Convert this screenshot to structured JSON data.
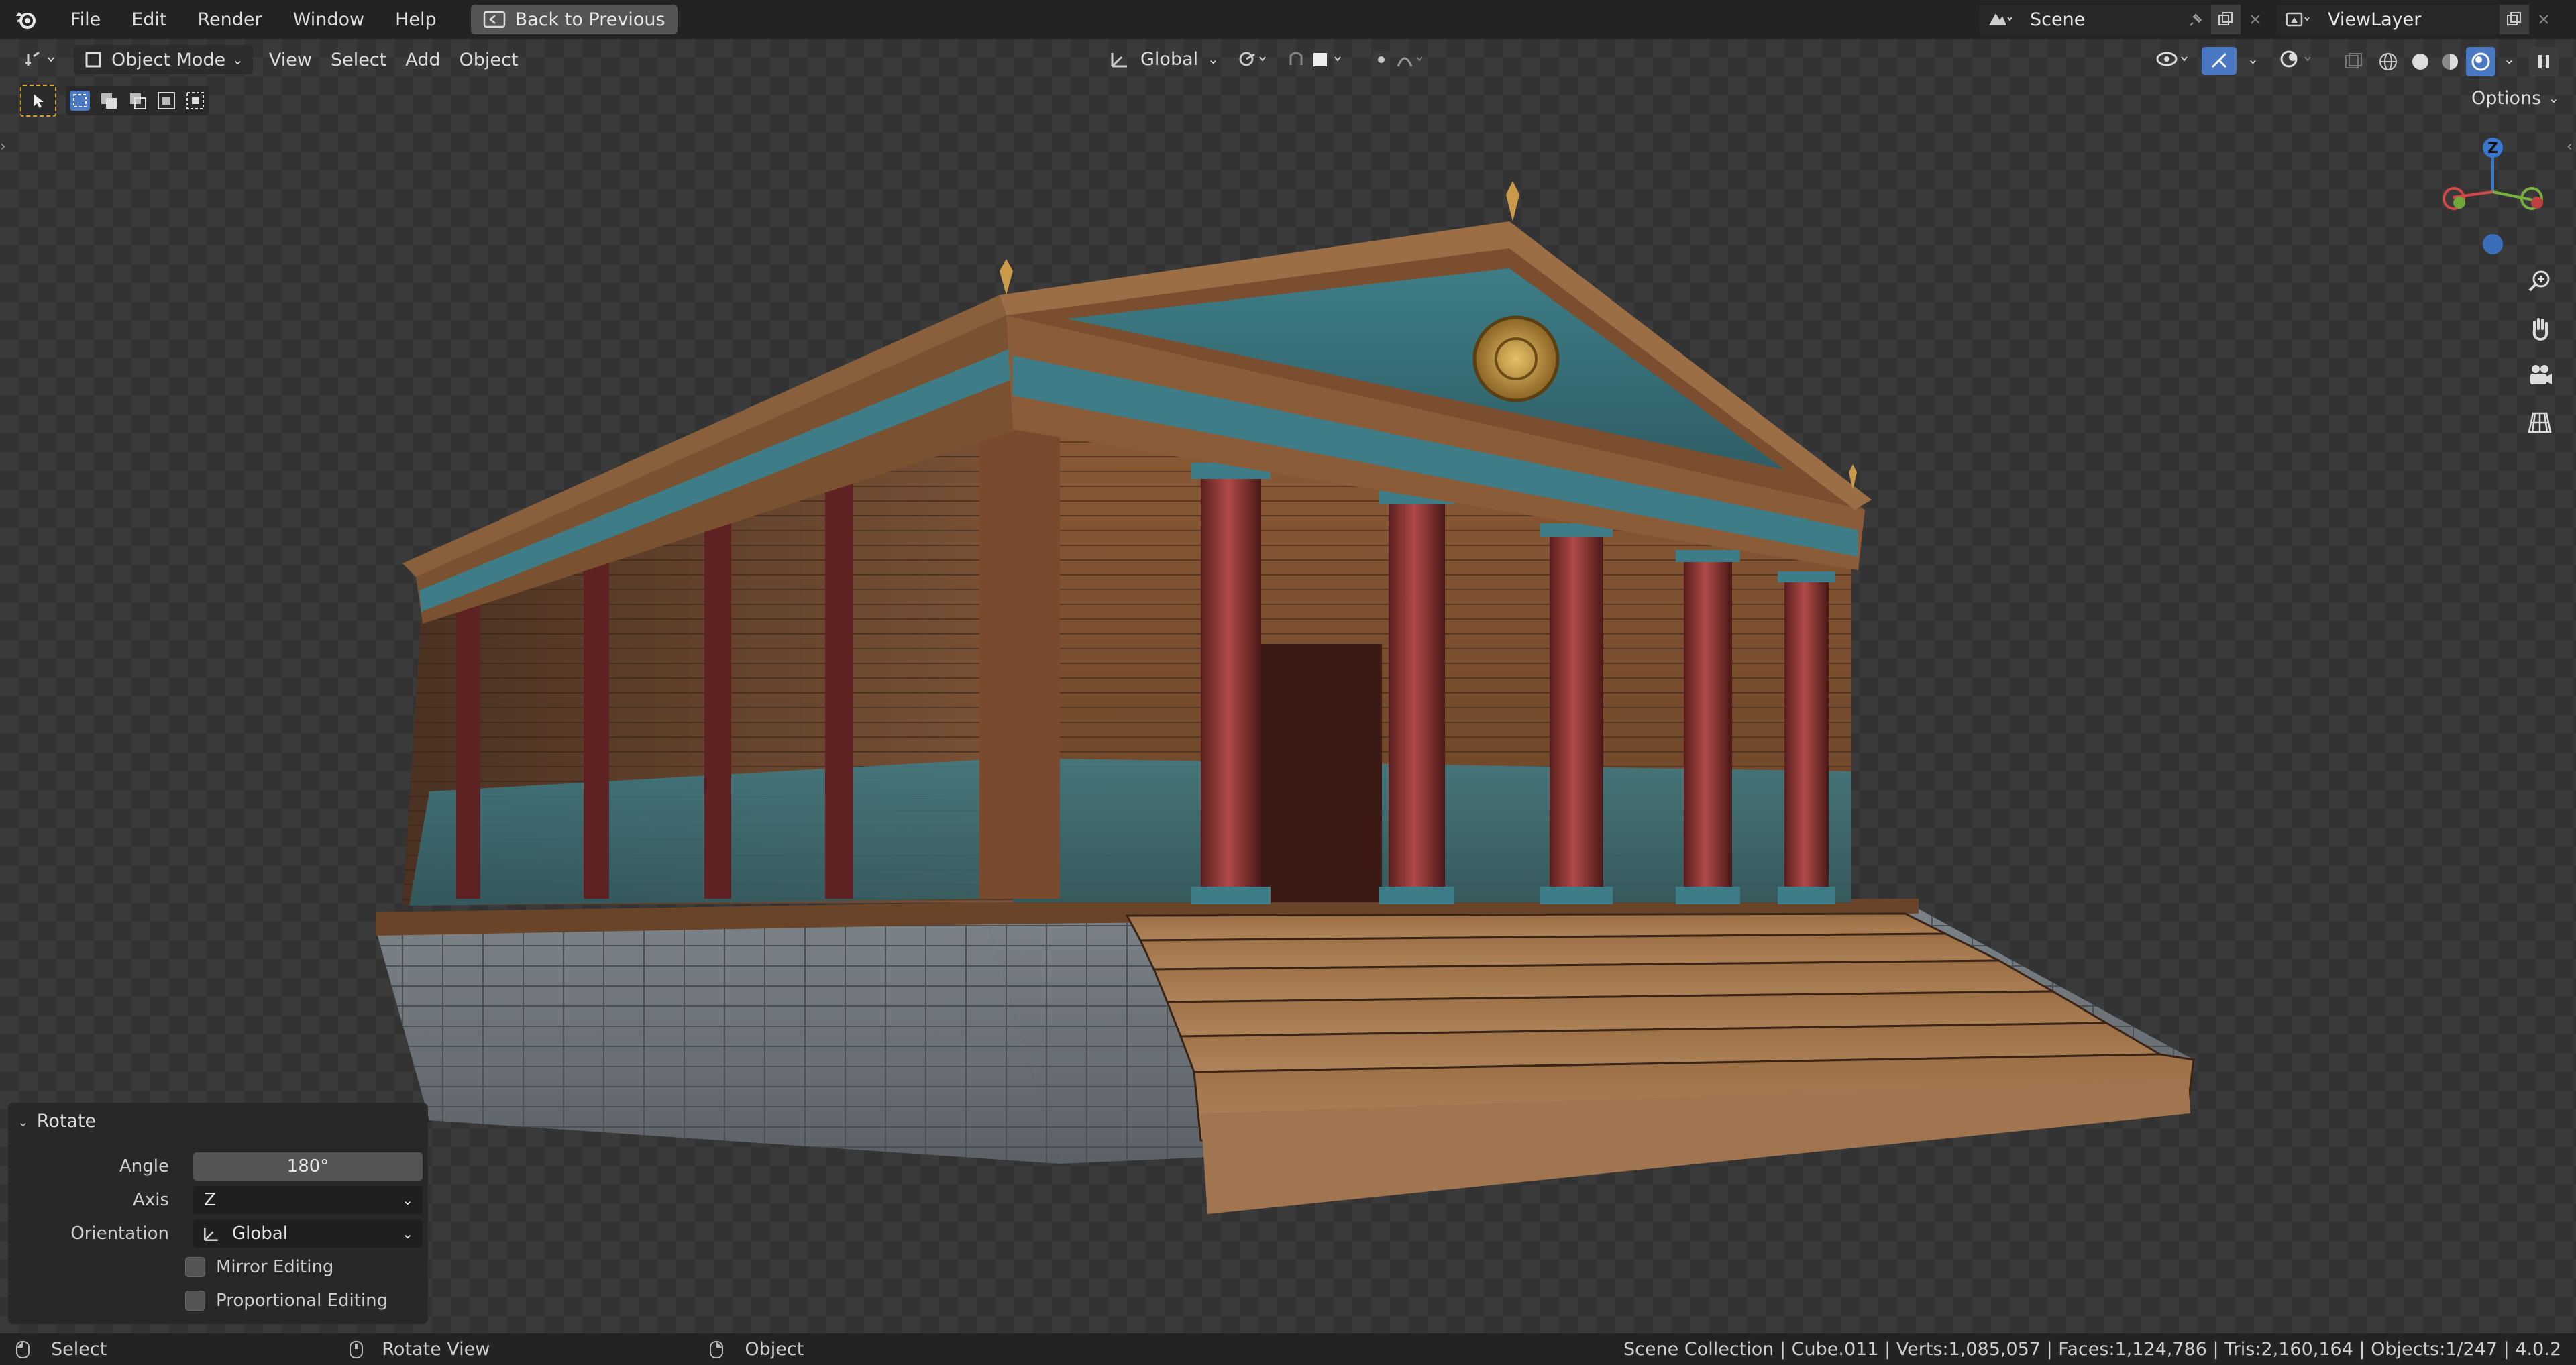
{
  "menu": {
    "file": "File",
    "edit": "Edit",
    "render": "Render",
    "window": "Window",
    "help": "Help",
    "back_btn": "Back to Previous"
  },
  "scene": {
    "name": "Scene"
  },
  "view_layer": {
    "name": "ViewLayer"
  },
  "header": {
    "mode": "Object Mode",
    "view": "View",
    "select": "Select",
    "add": "Add",
    "object": "Object",
    "orientation": "Global",
    "options": "Options"
  },
  "gizmo": {
    "z_label": "Z"
  },
  "operator_panel": {
    "title": "Rotate",
    "angle_label": "Angle",
    "angle_value": "180°",
    "axis_label": "Axis",
    "axis_value": "Z",
    "orientation_label": "Orientation",
    "orientation_value": "Global",
    "mirror_label": "Mirror Editing",
    "proportional_label": "Proportional Editing",
    "mirror_checked": false,
    "proportional_checked": false
  },
  "status": {
    "select": "Select",
    "rotate_view": "Rotate View",
    "object": "Object",
    "stats": "Scene Collection | Cube.011 | Verts:1,085,057 | Faces:1,124,786 | Tris:2,160,164 | Objects:1/247 | 4.0.2"
  },
  "colors": {
    "accent": "#4772b3",
    "active_blue": "#4a78c2",
    "bg": "#1d1d1d",
    "topbar": "#232323"
  },
  "icons": [
    "blender-logo-icon",
    "back-icon",
    "scene-icon",
    "pin-icon",
    "copy-icon",
    "close-icon",
    "layer-icon",
    "editor-type-icon",
    "mode-icon",
    "orientation-icon",
    "pivot-icon",
    "snap-icon",
    "proportional-icon",
    "visibility-icon",
    "gizmo-icon",
    "overlay-icon",
    "xray-icon",
    "shading-wireframe-icon",
    "shading-solid-icon",
    "shading-material-icon",
    "shading-rendered-icon",
    "zoom-icon",
    "hand-icon",
    "camera-icon",
    "grid-icon",
    "select-box-icon"
  ]
}
